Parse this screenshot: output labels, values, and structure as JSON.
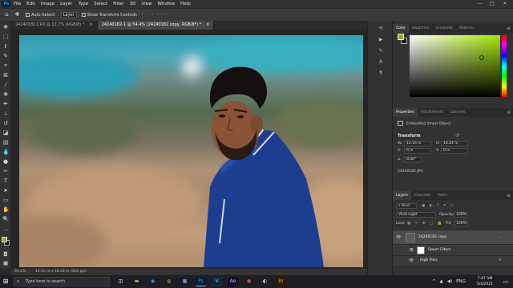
{
  "menubar": {
    "items": [
      "File",
      "Edit",
      "Image",
      "Layer",
      "Type",
      "Select",
      "Filter",
      "3D",
      "View",
      "Window",
      "Help"
    ],
    "app_logo": "Ps",
    "window_controls": [
      "minimize-icon",
      "maximize-icon",
      "close-icon"
    ]
  },
  "options": {
    "auto_select_label": "Auto-Select:",
    "layer_value": "Layer",
    "show_transform_label": "Show Transform Controls",
    "dots": "···  ·····"
  },
  "tabs": [
    {
      "label": "24240182.CR3 @ 12.7% (RGB/8) *",
      "close": "×"
    },
    {
      "label": "24240182-1 @ 54.4% (24240182 copy, RGB/8*) *",
      "close": "×"
    }
  ],
  "statusbar": {
    "zoom": "54.4%",
    "doc_info": "12.16 in x 18.24 in (300 ppi)"
  },
  "color_panel": {
    "tabs": [
      "Color",
      "Swatches",
      "Gradients",
      "Patterns"
    ],
    "foreground_color": "#8cb024",
    "background_color": "#1a1a1a"
  },
  "properties_panel": {
    "tabs": [
      "Properties",
      "Adjustments",
      "Libraries"
    ],
    "object_type": "Embedded Smart Object",
    "transform_heading": "Transform",
    "w_label": "W:",
    "w_value": "12.16 in",
    "h_label": "H:",
    "h_value": "18.24 in",
    "x_label": "X:",
    "x_value": "0 in",
    "y_label": "Y:",
    "y_value": "0 in",
    "angle_value": "0.00°",
    "file_name": "24240182.JPG"
  },
  "layers_panel": {
    "tabs": [
      "Layers",
      "Channels",
      "Paths"
    ],
    "kind_filter": "Kind",
    "blend_mode": "Vivid Light",
    "opacity_label": "Opacity:",
    "opacity_value": "100%",
    "lock_label": "Lock:",
    "fill_label": "Fill:",
    "fill_value": "100%",
    "layers": [
      {
        "name": "24240182 copy",
        "selected": true
      },
      {
        "name": "Smart Filters",
        "selected": false
      },
      {
        "name": "High Pass",
        "selected": false
      }
    ]
  },
  "taskbar": {
    "search_placeholder": "Type here to search",
    "apps": [
      "Ps",
      "V",
      "Ae",
      "Br"
    ],
    "time": "7:47 AM",
    "date": "5/4/2021",
    "lang": "ENG"
  }
}
